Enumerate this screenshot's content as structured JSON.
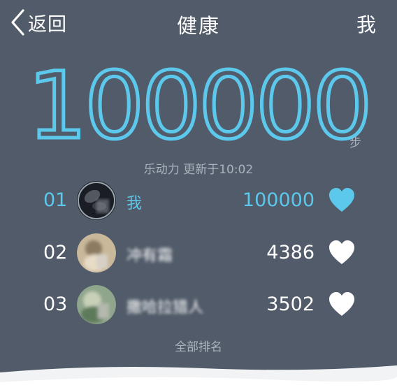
{
  "nav": {
    "back_label": "返回",
    "title": "健康",
    "me_label": "我"
  },
  "steps": {
    "count": "100000",
    "unit": "步",
    "update_text": "乐动力 更新于10:02"
  },
  "colors": {
    "background": "#515b69",
    "accent": "#5bc8ec",
    "muted_text": "#aab2bd",
    "heart_self": "#5bc8ec",
    "heart_other": "#ffffff"
  },
  "ranking": [
    {
      "rank": "01",
      "name": "我",
      "steps": "100000",
      "is_self": true,
      "avatar": "avatar-dark",
      "liked": true
    },
    {
      "rank": "02",
      "name": "冲有霜",
      "steps": "4386",
      "is_self": false,
      "avatar": "avatar-light",
      "liked": false
    },
    {
      "rank": "03",
      "name": "撒哈拉猎人",
      "steps": "3502",
      "is_self": false,
      "avatar": "avatar-green",
      "liked": false
    }
  ],
  "footer": {
    "all_ranking_label": "全部排名"
  }
}
